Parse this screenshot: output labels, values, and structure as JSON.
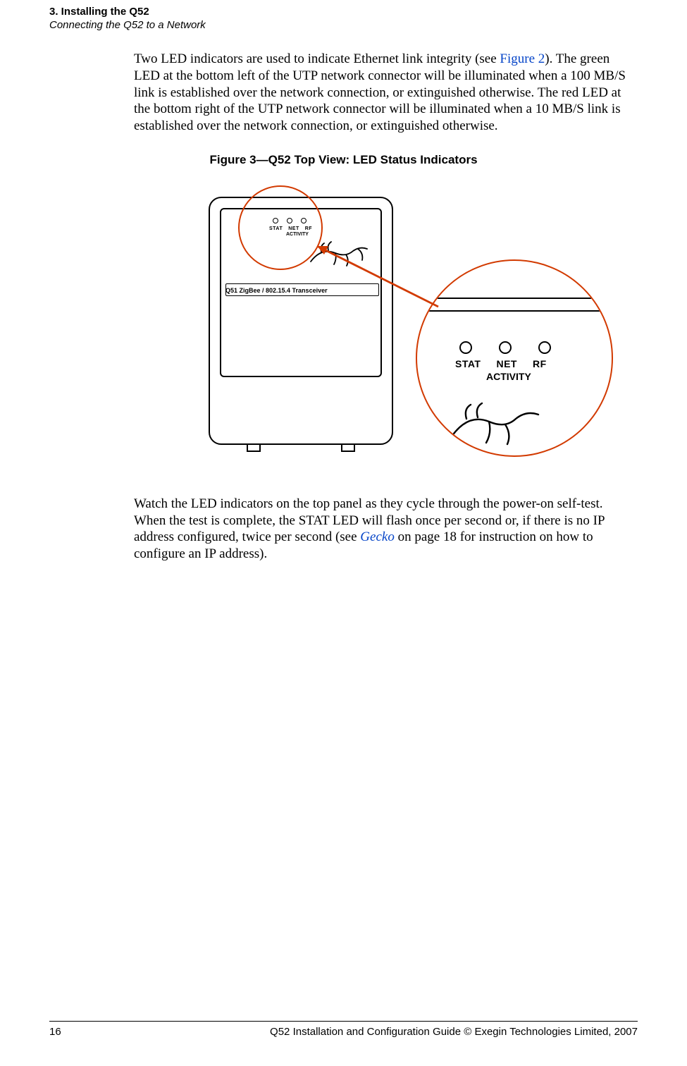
{
  "header": {
    "section": "3. Installing the Q52",
    "subsection": "Connecting the Q52 to a Network"
  },
  "paragraphs": {
    "p1_a": "Two LED indicators are used to indicate Ethernet link integrity (see ",
    "p1_link": "Figure 2",
    "p1_b": "). The green LED at the bottom left of the UTP network connector will be illuminated when a 100 MB/S link is established over the network connection, or extinguished otherwise. The red LED at the bottom right of the UTP network connector will be illuminated when a 10 MB/S link is established over the network connection, or extinguished otherwise.",
    "p2_a": "Watch the LED indicators on the top panel as they cycle through the power-on self-test. When the test is complete, the STAT LED will flash once per second or, if there is no IP address configured, twice per second (see ",
    "p2_link": "Gecko",
    "p2_b": " on page 18 for instruction on how to configure an IP address)."
  },
  "figure": {
    "caption": "Figure 3—Q52 Top View: LED Status Indicators",
    "device_label": "Q51 ZigBee / 802.15.4 Transceiver",
    "leds": {
      "l1": "STAT",
      "l2": "NET",
      "l3": "RF",
      "activity": "ACTIVITY"
    }
  },
  "footer": {
    "page": "16",
    "text": "Q52 Installation and Configuration Guide  © Exegin Technologies Limited, 2007"
  }
}
